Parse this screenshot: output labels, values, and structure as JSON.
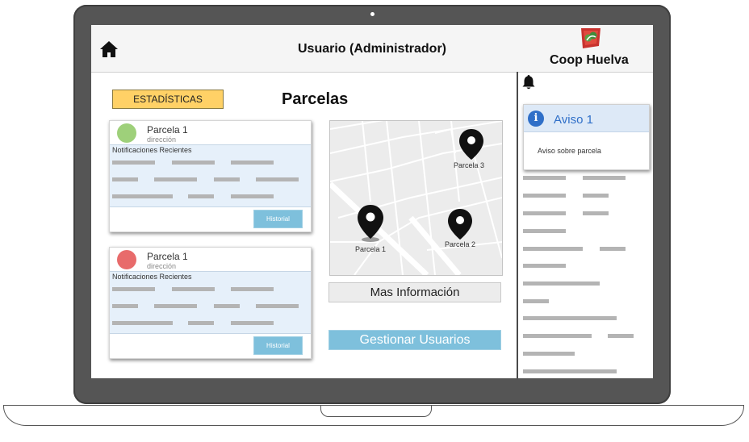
{
  "header": {
    "title": "Usuario (Administrador)",
    "brand": "Coop Huelva",
    "home_icon": "home-icon",
    "logo_icon": "coop-logo-icon"
  },
  "main": {
    "stats_button": "ESTADÍSTICAS",
    "section_title": "Parcelas",
    "parcels": [
      {
        "title": "Parcela 1",
        "subtitle": "dirección",
        "status_color": "#9ed07a",
        "notifications_label": "Notificaciones Recientes",
        "history_button": "Historial"
      },
      {
        "title": "Parcela 1",
        "subtitle": "dirección",
        "status_color": "#e86b6b",
        "notifications_label": "Notificaciones Recientes",
        "history_button": "Historial"
      }
    ],
    "map": {
      "pins": [
        "Parcela 1",
        "Parcela 2",
        "Parcela 3"
      ]
    },
    "more_info_button": "Mas Información",
    "manage_users_button": "Gestionar Usuarios"
  },
  "notifications_panel": {
    "bell_icon": "bell-icon",
    "alert": {
      "title": "Aviso 1",
      "text": "Aviso sobre parcela",
      "icon": "info-icon"
    }
  },
  "colors": {
    "accent_button": "#7ec0dc",
    "stats_button": "#ffd166",
    "alert_title": "#2f6fc8"
  }
}
